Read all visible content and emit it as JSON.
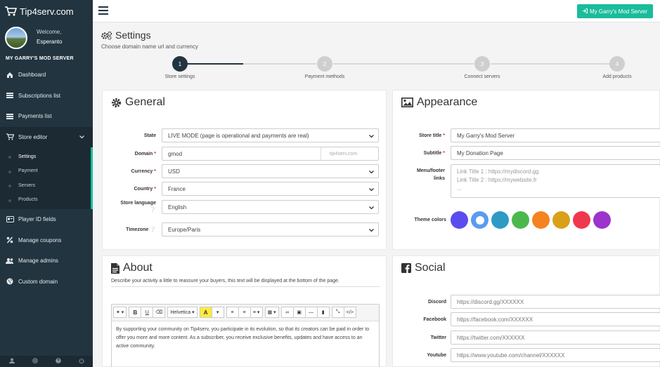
{
  "app": {
    "logo_text": "Tip4serv.com"
  },
  "profile": {
    "welcome": "Welcome,",
    "username": "Esperanto"
  },
  "sidebar": {
    "server_name": "MY GARRY'S MOD SERVER",
    "items": [
      {
        "label": "Dashboard",
        "icon": "home-icon"
      },
      {
        "label": "Subscriptions list",
        "icon": "list-icon"
      },
      {
        "label": "Payments list",
        "icon": "list-icon"
      },
      {
        "label": "Store editor",
        "icon": "cart-icon"
      },
      {
        "label": "Player ID fields",
        "icon": "id-card-icon"
      },
      {
        "label": "Manage coupons",
        "icon": "percent-icon"
      },
      {
        "label": "Manage admins",
        "icon": "users-icon"
      },
      {
        "label": "Custom domain",
        "icon": "globe-icon"
      }
    ],
    "store_editor_sub": [
      {
        "label": "Settings"
      },
      {
        "label": "Payment"
      },
      {
        "label": "Servers"
      },
      {
        "label": "Products"
      }
    ]
  },
  "topbar": {
    "server_button": "My Garry's Mod Server"
  },
  "page": {
    "title": "Settings",
    "subtitle": "Choose domain name url and currency"
  },
  "steps": [
    {
      "num": "1",
      "label": "Store settings"
    },
    {
      "num": "2",
      "label": "Payment methods"
    },
    {
      "num": "3",
      "label": "Connect servers"
    },
    {
      "num": "4",
      "label": "Add products"
    }
  ],
  "general": {
    "title": "General",
    "state_label": "State",
    "state_value": "LIVE MODE (page is operational and payments are real)",
    "domain_label": "Domain",
    "domain_value": "gmod",
    "domain_suffix": "tip4serv.com",
    "currency_label": "Currency",
    "currency_value": "USD",
    "country_label": "Country",
    "country_value": "France",
    "language_label": "Store language",
    "language_value": "English",
    "timezone_label": "Timezone",
    "timezone_value": "Europe/Paris"
  },
  "appearance": {
    "title": "Appearance",
    "store_title_label": "Store title",
    "store_title_value": "My Garry's Mod Server",
    "subtitle_label": "Subtitle",
    "subtitle_value": "My Donation Page",
    "links_label": "Menu/footer links",
    "links_line1": "Link Title 1 : https://mydiscord.gg",
    "links_line2": "Link Title 2 : https://mywebsite.fr",
    "links_line3": "...",
    "theme_label": "Theme colors",
    "theme_colors": [
      "#5b4cf0",
      "#5a9cf0",
      "#2e9bc4",
      "#4cb84c",
      "#f5831f",
      "#d9a11a",
      "#f0384c",
      "#9b33cc"
    ]
  },
  "about": {
    "title": "About",
    "description": "Describe your activity a little to reassure your buyers, this text will be displayed at the bottom of the page.",
    "font_name": "Helvetica",
    "text": "By supporting your community on Tip4serv, you participate in its evolution, so that its creators can be paid in order to offer you more and more content. As a subscriber, you receive exclusive benefits, updates and have access to an active community."
  },
  "social": {
    "title": "Social",
    "discord_label": "Discord",
    "discord_value": "https://discord.gg/XXXXXX",
    "facebook_label": "Facebook",
    "facebook_value": "https://facebook.com/XXXXXX",
    "twitter_label": "Twitter",
    "twitter_value": "https://twitter.com/XXXXXX",
    "youtube_label": "Youtube",
    "youtube_value": "https://www.youtube.com/channel/XXXXXX"
  }
}
